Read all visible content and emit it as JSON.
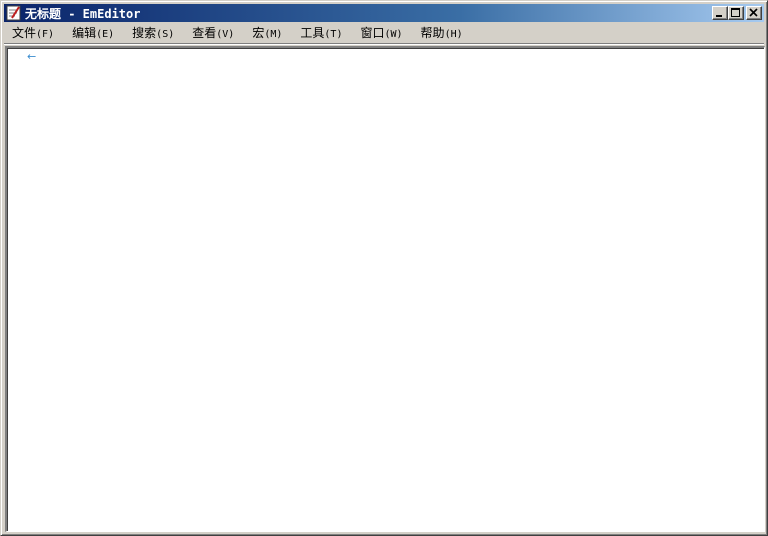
{
  "window": {
    "title": "无标题 - EmEditor",
    "icon": "emeditor-app-icon"
  },
  "title_buttons": {
    "minimize_icon": "minimize-icon",
    "maximize_icon": "maximize-icon",
    "close_icon": "close-icon"
  },
  "menubar": {
    "items": [
      {
        "label": "文件",
        "accel": "(F)"
      },
      {
        "label": "编辑",
        "accel": "(E)"
      },
      {
        "label": "搜索",
        "accel": "(S)"
      },
      {
        "label": "查看",
        "accel": "(V)"
      },
      {
        "label": "宏",
        "accel": "(M)"
      },
      {
        "label": "工具",
        "accel": "(T)"
      },
      {
        "label": "窗口",
        "accel": "(W)"
      },
      {
        "label": "帮助",
        "accel": "(H)"
      }
    ]
  },
  "editor": {
    "eof_mark": "←",
    "eof_color": "#3a8ccf"
  },
  "colors": {
    "title_start": "#0a246a",
    "title_end": "#a6caf0",
    "chrome": "#d4d0c8"
  }
}
